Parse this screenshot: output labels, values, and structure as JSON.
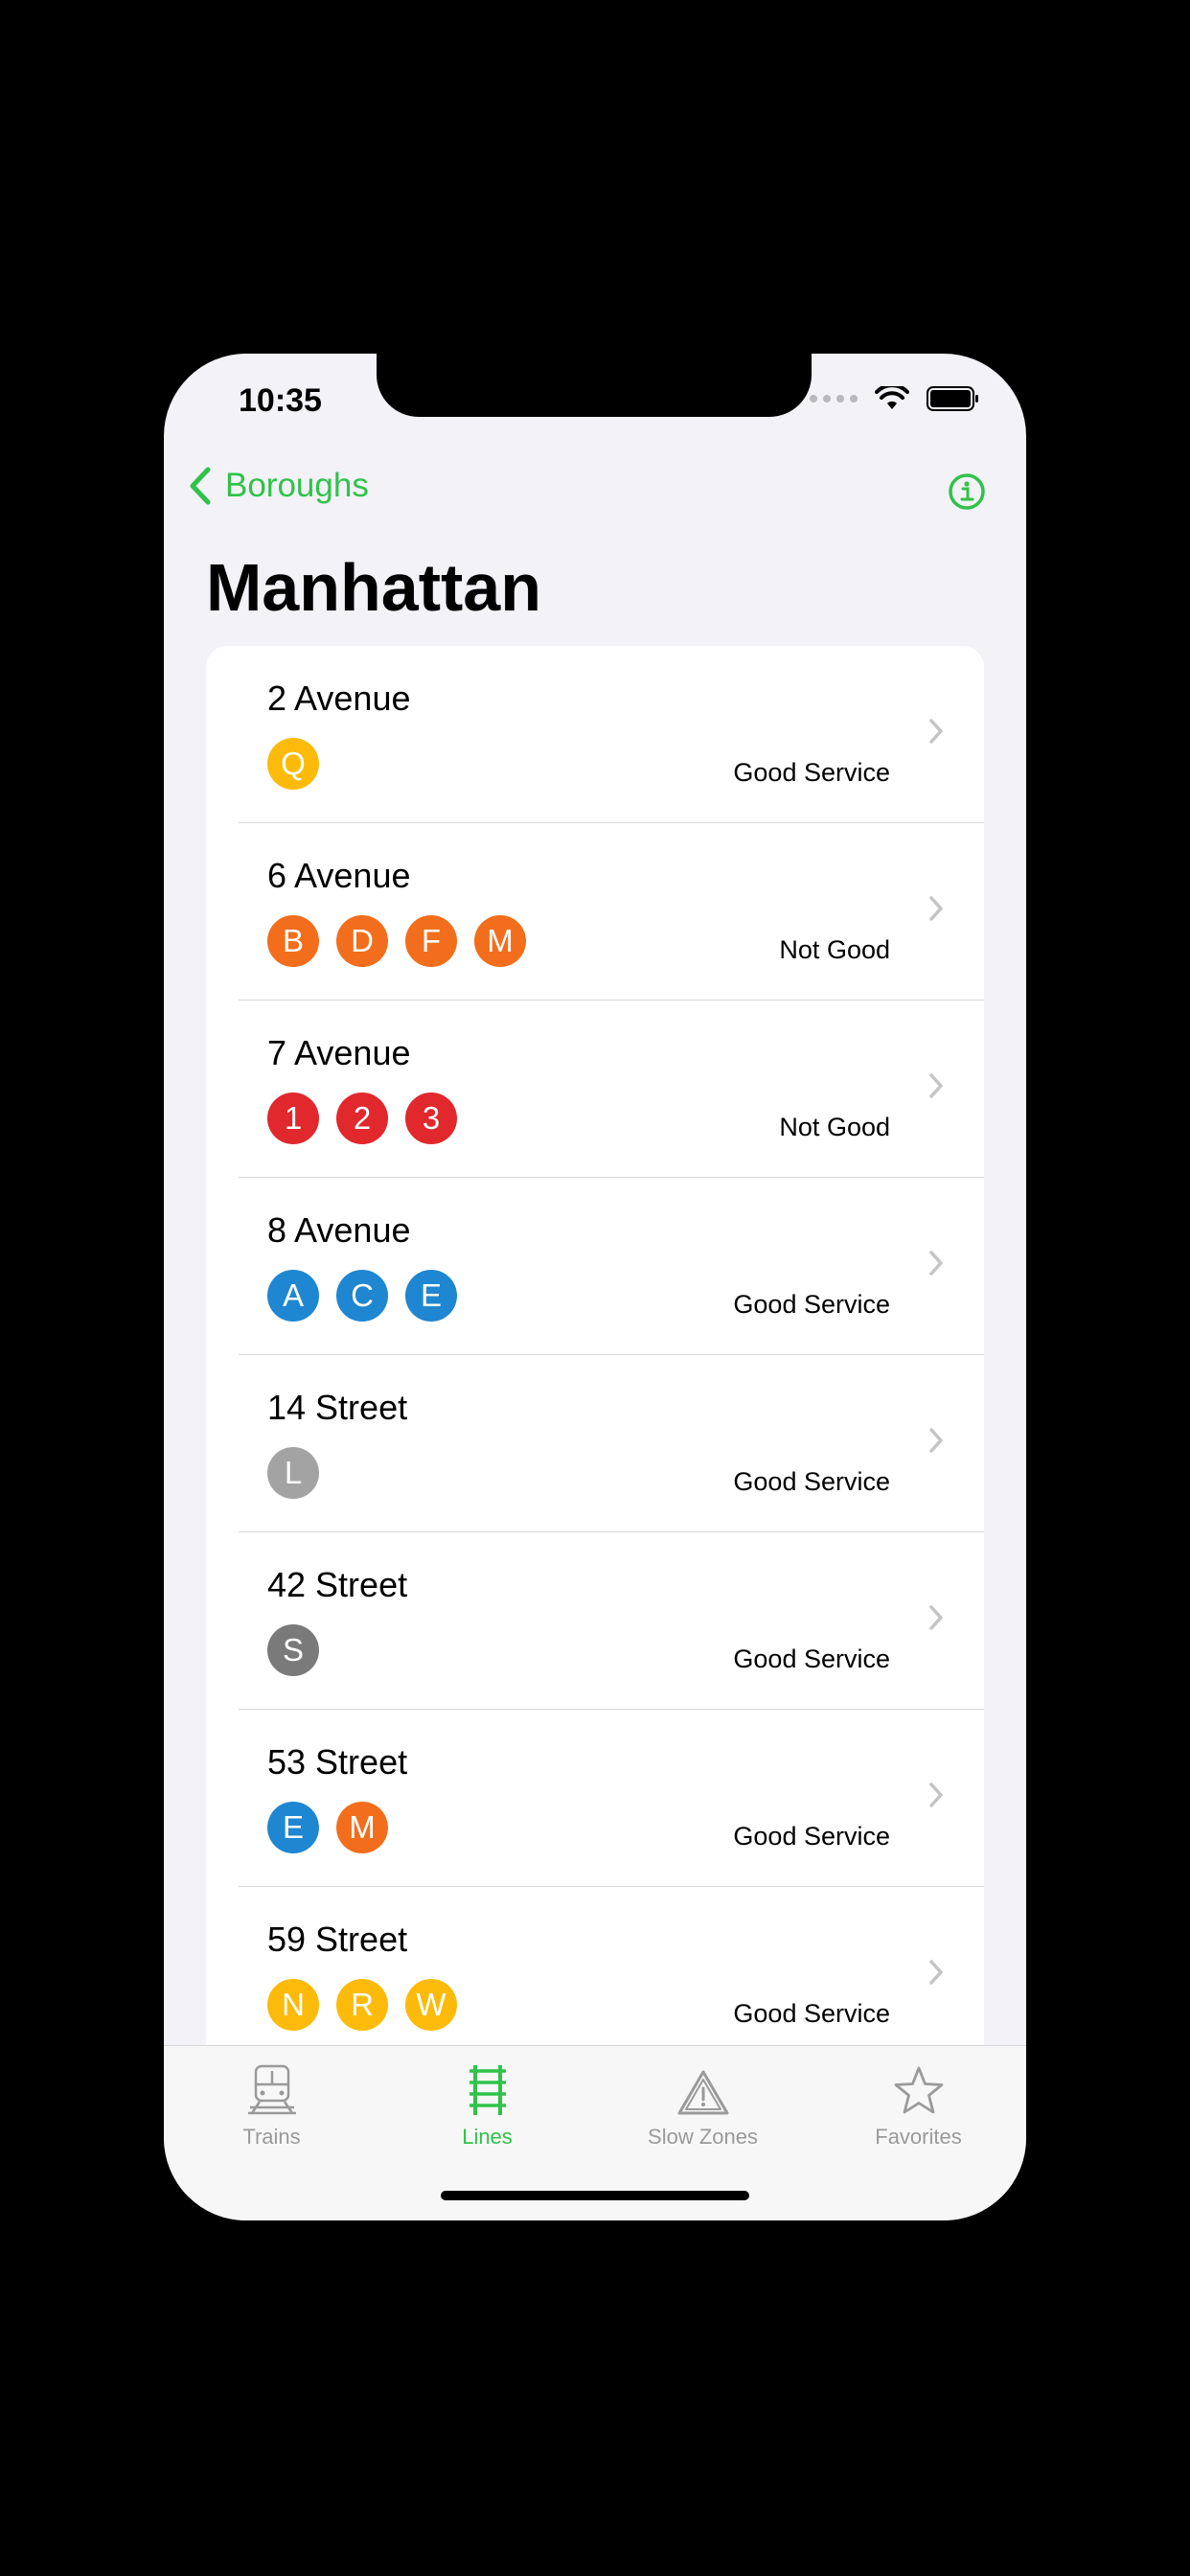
{
  "status": {
    "time": "10:35"
  },
  "nav": {
    "back_label": "Boroughs"
  },
  "page": {
    "title": "Manhattan"
  },
  "colors": {
    "accent": "#30c24a",
    "yellow": "#fcbb0a",
    "orange": "#f26e1c",
    "red": "#e0282d",
    "blue": "#1f86d1",
    "gray": "#a3a3a3",
    "darkgray": "#7a7a7a"
  },
  "rows": [
    {
      "name": "2 Avenue",
      "status": "Good Service",
      "bullets": [
        {
          "label": "Q",
          "color": "#fcbb0a"
        }
      ]
    },
    {
      "name": "6 Avenue",
      "status": "Not Good",
      "bullets": [
        {
          "label": "B",
          "color": "#f26e1c"
        },
        {
          "label": "D",
          "color": "#f26e1c"
        },
        {
          "label": "F",
          "color": "#f26e1c"
        },
        {
          "label": "M",
          "color": "#f26e1c"
        }
      ]
    },
    {
      "name": "7 Avenue",
      "status": "Not Good",
      "bullets": [
        {
          "label": "1",
          "color": "#e0282d"
        },
        {
          "label": "2",
          "color": "#e0282d"
        },
        {
          "label": "3",
          "color": "#e0282d"
        }
      ]
    },
    {
      "name": "8 Avenue",
      "status": "Good Service",
      "bullets": [
        {
          "label": "A",
          "color": "#1f86d1"
        },
        {
          "label": "C",
          "color": "#1f86d1"
        },
        {
          "label": "E",
          "color": "#1f86d1"
        }
      ]
    },
    {
      "name": "14 Street",
      "status": "Good Service",
      "bullets": [
        {
          "label": "L",
          "color": "#a3a3a3"
        }
      ]
    },
    {
      "name": "42 Street",
      "status": "Good Service",
      "bullets": [
        {
          "label": "S",
          "color": "#7a7a7a"
        }
      ]
    },
    {
      "name": "53 Street",
      "status": "Good Service",
      "bullets": [
        {
          "label": "E",
          "color": "#1f86d1"
        },
        {
          "label": "M",
          "color": "#f26e1c"
        }
      ]
    },
    {
      "name": "59 Street",
      "status": "Good Service",
      "bullets": [
        {
          "label": "N",
          "color": "#fcbb0a"
        },
        {
          "label": "R",
          "color": "#fcbb0a"
        },
        {
          "label": "W",
          "color": "#fcbb0a"
        }
      ]
    }
  ],
  "tabs": [
    {
      "label": "Trains",
      "icon": "train-icon",
      "active": false
    },
    {
      "label": "Lines",
      "icon": "tracks-icon",
      "active": true
    },
    {
      "label": "Slow Zones",
      "icon": "warning-triangle-icon",
      "active": false
    },
    {
      "label": "Favorites",
      "icon": "star-icon",
      "active": false
    }
  ]
}
